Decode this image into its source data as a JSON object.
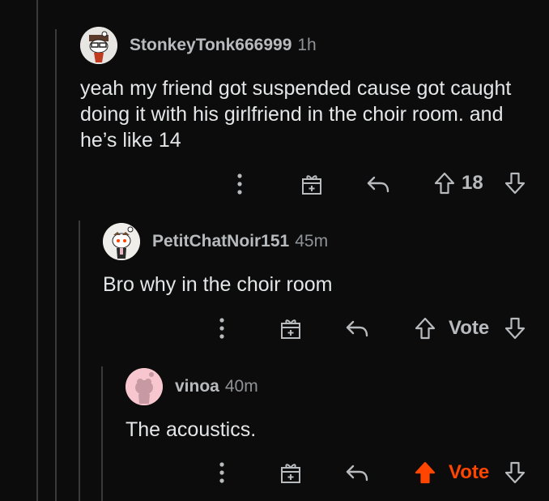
{
  "comments": [
    {
      "username": "StonkeyTonk666999",
      "time": "1h",
      "body": "yeah my friend got suspended cause got caught doing it with his girlfriend in the choir room. and he’s like 14",
      "score": "18",
      "voted": false
    },
    {
      "username": "PetitChatNoir151",
      "time": "45m",
      "body": "Bro why in the choir room",
      "score": "Vote",
      "voted": false
    },
    {
      "username": "vinoa",
      "time": "40m",
      "body": "The acoustics.",
      "score": "Vote",
      "voted": true
    }
  ],
  "colors": {
    "background": "#0c0c0c",
    "upvote_active": "#ff4500",
    "icon": "#b8bbbe",
    "thread_line": "#3a3a3a"
  },
  "icons": [
    "more-options-icon",
    "award-gift-icon",
    "reply-icon",
    "upvote-icon",
    "downvote-icon"
  ]
}
